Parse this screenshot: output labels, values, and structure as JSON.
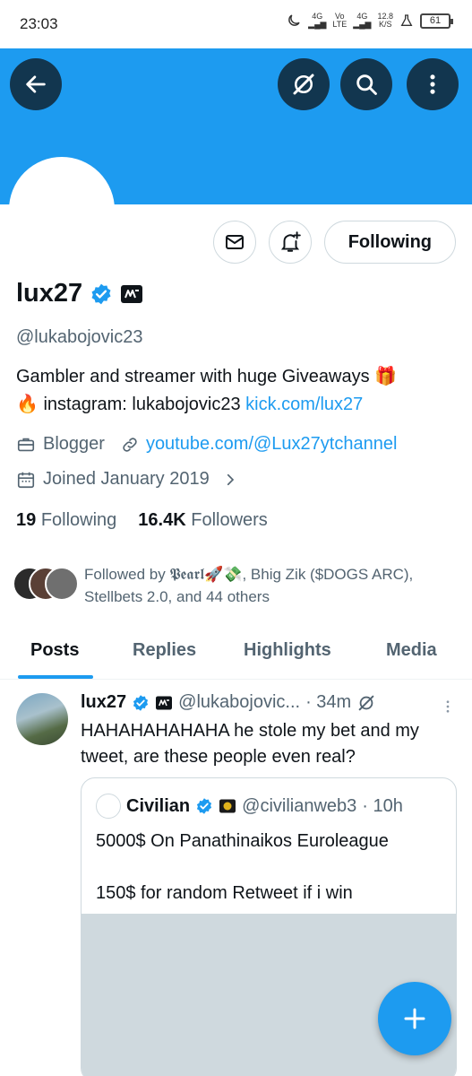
{
  "status_bar": {
    "time": "23:03",
    "net1": "4G",
    "net2_top": "Vo",
    "net2_bottom": "LTE",
    "net3": "4G",
    "speed_top": "12.8",
    "speed_bottom": "K/S",
    "battery": "61"
  },
  "profile": {
    "name": "lux27",
    "handle": "@lukabojovic23",
    "bio_line1": "Gambler and streamer with huge Giveaways 🎁",
    "bio_line2_prefix": "🔥 instagram: lukabojovic23 ",
    "bio_link": "kick.com/lux27",
    "category": "Blogger",
    "website": "youtube.com/@Lux27ytchannel",
    "joined": "Joined January 2019",
    "following_count": "19",
    "following_label": "Following",
    "followers_count": "16.4K",
    "followers_label": "Followers",
    "followed_by": "Followed by 𝕻𝖊𝖆𝖗𝖑🚀💸, Bhig Zik ($DOGS ARC), Stellbets 2.0, and 44 others"
  },
  "actions": {
    "following_button": "Following"
  },
  "tabs": [
    {
      "label": "Posts",
      "active": true
    },
    {
      "label": "Replies",
      "active": false
    },
    {
      "label": "Highlights",
      "active": false
    },
    {
      "label": "Media",
      "active": false
    }
  ],
  "post": {
    "author": "lux27",
    "handle": "@lukabojovic...",
    "time": "· 34m",
    "text": "HAHAHAHAHAHA he stole my bet and my tweet, are these people even real?",
    "quote": {
      "author": "Civilian",
      "handle": "@civilianweb3",
      "time": "· 10h",
      "text": "5000$ On Panathinaikos Euroleague\n\n150$ for random Retweet if i win"
    }
  },
  "colors": {
    "accent": "#1d9bf0",
    "text": "#0f1419",
    "secondary": "#536471",
    "border": "#cfd9de"
  },
  "icons": [
    "back-arrow-icon",
    "grok-icon",
    "search-icon",
    "more-vertical-icon",
    "mail-icon",
    "bell-plus-icon",
    "verified-badge-icon",
    "affiliate-badge-icon",
    "briefcase-icon",
    "link-icon",
    "calendar-icon",
    "chevron-right-icon",
    "plus-icon"
  ]
}
